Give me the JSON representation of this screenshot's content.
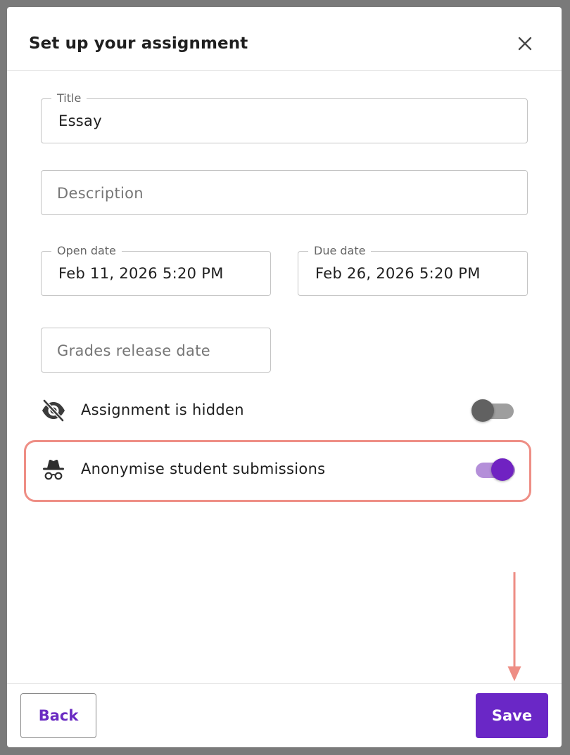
{
  "dialog": {
    "title": "Set up your assignment",
    "close_icon": "close-icon"
  },
  "fields": {
    "title": {
      "label": "Title",
      "value": "Essay"
    },
    "description": {
      "placeholder": "Description"
    },
    "open_date": {
      "label": "Open date",
      "value": "Feb 11, 2026 5:20 PM"
    },
    "due_date": {
      "label": "Due date",
      "value": "Feb 26, 2026 5:20 PM"
    },
    "grades_release": {
      "placeholder": "Grades release date"
    }
  },
  "settings": {
    "hidden": {
      "label": "Assignment is hidden",
      "icon": "eye-off-icon",
      "enabled": false
    },
    "anonymise": {
      "label": "Anonymise student submissions",
      "icon": "incognito-icon",
      "enabled": true
    }
  },
  "footer": {
    "back_label": "Back",
    "save_label": "Save"
  },
  "colors": {
    "accent": "#6a27c6",
    "toggle_on_thumb": "#7022c2",
    "toggle_on_track": "#b48fd9",
    "toggle_off_thumb": "#616161",
    "toggle_off_track": "#9e9e9e",
    "highlight": "#ee8e85"
  }
}
